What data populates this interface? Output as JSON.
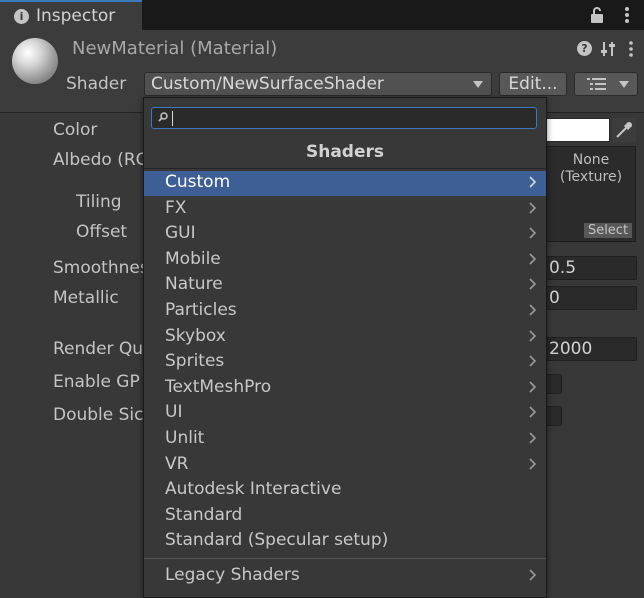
{
  "tab": {
    "title": "Inspector"
  },
  "material": {
    "name": "NewMaterial (Material)",
    "shader_label": "Shader",
    "shader_value": "Custom/NewSurfaceShader",
    "edit_label": "Edit..."
  },
  "properties": {
    "color": "Color",
    "albedo": "Albedo (RG",
    "tiling": "Tiling",
    "offset": "Offset",
    "smoothness": "Smoothness",
    "metallic": "Metallic",
    "render_queue": "Render Qu",
    "enable_gpu": "Enable GP",
    "double_sided": "Double Sic",
    "color_value": "#ffffff",
    "texture_none": "None",
    "texture_type": "(Texture)",
    "texture_select": "Select",
    "smoothness_value": "0.5",
    "metallic_value": "0",
    "render_queue_value": "2000"
  },
  "popup": {
    "search_value": "",
    "title": "Shaders",
    "items": [
      {
        "label": "Custom",
        "submenu": true,
        "selected": true
      },
      {
        "label": "FX",
        "submenu": true
      },
      {
        "label": "GUI",
        "submenu": true
      },
      {
        "label": "Mobile",
        "submenu": true
      },
      {
        "label": "Nature",
        "submenu": true
      },
      {
        "label": "Particles",
        "submenu": true
      },
      {
        "label": "Skybox",
        "submenu": true
      },
      {
        "label": "Sprites",
        "submenu": true
      },
      {
        "label": "TextMeshPro",
        "submenu": true
      },
      {
        "label": "UI",
        "submenu": true
      },
      {
        "label": "Unlit",
        "submenu": true
      },
      {
        "label": "VR",
        "submenu": true
      },
      {
        "label": "Autodesk Interactive",
        "submenu": false
      },
      {
        "label": "Standard",
        "submenu": false
      },
      {
        "label": "Standard (Specular setup)",
        "submenu": false
      }
    ],
    "legacy": {
      "label": "Legacy Shaders",
      "submenu": true
    }
  },
  "colors": {
    "accent": "#3a79bb",
    "selection": "#3e5f96",
    "panel": "#383838",
    "header": "#3c3c3c"
  }
}
